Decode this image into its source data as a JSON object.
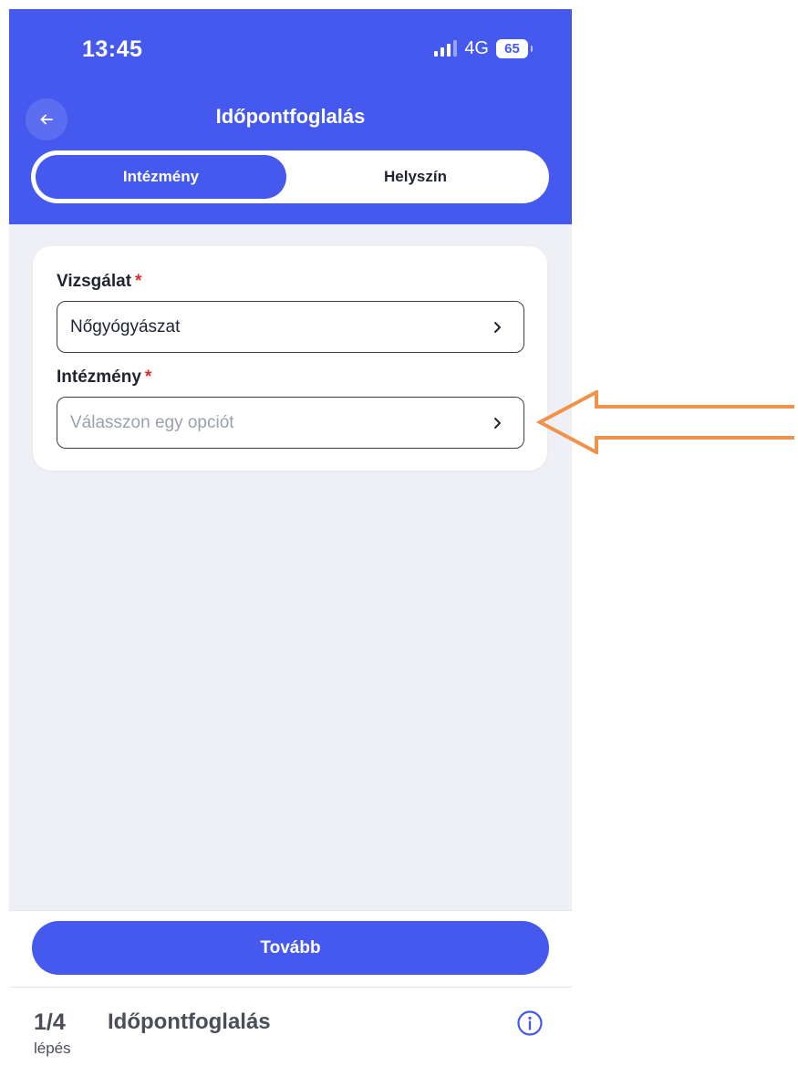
{
  "status_bar": {
    "time": "13:45",
    "network": "4G",
    "battery": "65"
  },
  "header": {
    "title": "Időpontfoglalás",
    "back_icon": "arrow-left-icon"
  },
  "segment": {
    "options": [
      "Intézmény",
      "Helyszín"
    ],
    "selected": "Intézmény"
  },
  "form": {
    "exam": {
      "label": "Vizsgálat",
      "required_mark": "*",
      "value": "Nőgyógyászat"
    },
    "institution": {
      "label": "Intézmény",
      "required_mark": "*",
      "placeholder": "Válasszon egy opciót"
    }
  },
  "footer": {
    "next_label": "Tovább",
    "step_number": "1/4",
    "step_word": "lépés",
    "step_title": "Időpontfoglalás",
    "info_icon": "info-circle-icon"
  },
  "colors": {
    "primary": "#4559ef",
    "background": "#eef0f5",
    "required": "#d92b2b",
    "annotation_arrow": "#f0924a"
  }
}
